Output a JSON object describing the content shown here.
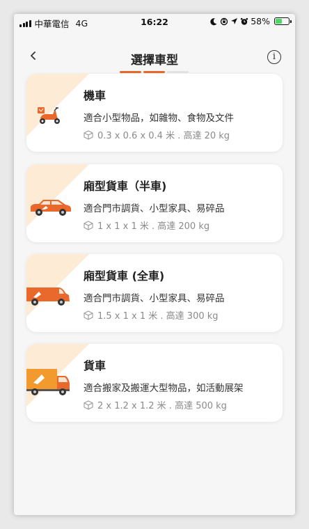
{
  "status_bar": {
    "carrier": "中華電信",
    "network": "4G",
    "time": "16:22",
    "battery": "58%",
    "battery_level": 0.58
  },
  "header": {
    "title": "選擇車型",
    "progress_steps": 3,
    "progress_active": 2,
    "accent_color": "#e8692b"
  },
  "vehicles": [
    {
      "name": "機車",
      "description": "適合小型物品，如雜物、食物及文件",
      "spec": "0.3 x 0.6 x 0.4 米 . 高達 20 kg",
      "icon": "scooter-icon"
    },
    {
      "name": "廂型貨車（半車)",
      "description": "適合門市調貨、小型家具、易碎品",
      "spec": "1 x 1 x 1 米 . 高達 200 kg",
      "icon": "suv-icon"
    },
    {
      "name": "廂型貨車 (全車)",
      "description": "適合門市調貨、小型家具、易碎品",
      "spec": "1.5 x 1 x 1 米 . 高達 300 kg",
      "icon": "van-icon"
    },
    {
      "name": "貨車",
      "description": "適合搬家及搬運大型物品，如活動展架",
      "spec": "2 x 1.2 x 1.2 米 . 高達 500 kg",
      "icon": "truck-icon"
    }
  ]
}
